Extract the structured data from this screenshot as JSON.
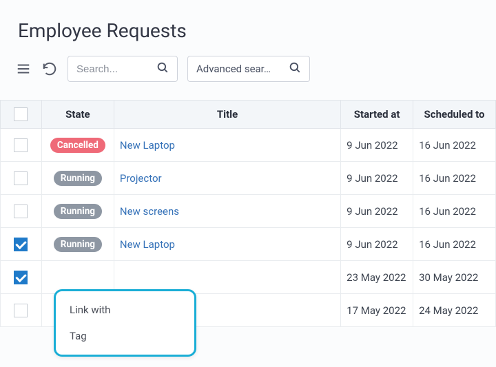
{
  "page": {
    "title": "Employee Requests"
  },
  "toolbar": {
    "search_placeholder": "Search...",
    "advanced_label": "Advanced sear…"
  },
  "columns": {
    "state": "State",
    "title": "Title",
    "started": "Started at",
    "scheduled": "Scheduled to"
  },
  "rows": [
    {
      "checked": false,
      "state": "Cancelled",
      "state_kind": "cancelled",
      "title": "New Laptop",
      "started": "9 Jun 2022",
      "scheduled": "16 Jun 2022"
    },
    {
      "checked": false,
      "state": "Running",
      "state_kind": "running",
      "title": "Projector",
      "started": "9 Jun 2022",
      "scheduled": "16 Jun 2022"
    },
    {
      "checked": false,
      "state": "Running",
      "state_kind": "running",
      "title": "New screens",
      "started": "9 Jun 2022",
      "scheduled": "16 Jun 2022"
    },
    {
      "checked": true,
      "state": "Running",
      "state_kind": "running",
      "title": "New Laptop",
      "started": "9 Jun 2022",
      "scheduled": "16 Jun 2022"
    },
    {
      "checked": true,
      "state": "",
      "state_kind": "cancelled",
      "title": "",
      "started": "23 May 2022",
      "scheduled": "30 May 2022"
    },
    {
      "checked": false,
      "state": "",
      "state_kind": "",
      "title": "",
      "started": "17 May 2022",
      "scheduled": "24 May 2022"
    }
  ],
  "context_menu": {
    "item1": "Link with",
    "item2": "Tag"
  }
}
